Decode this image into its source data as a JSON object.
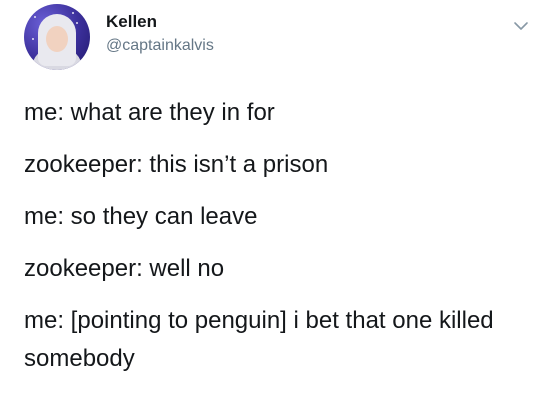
{
  "user": {
    "name": "Kellen",
    "handle": "@captainkalvis"
  },
  "tweet": {
    "lines": [
      "me: what are they in for",
      "zookeeper: this isn’t a prison",
      "me: so they can leave",
      "zookeeper: well no",
      "me: [pointing to penguin] i bet that one killed somebody"
    ]
  },
  "icons": {
    "menu": "chevron-down-icon"
  }
}
